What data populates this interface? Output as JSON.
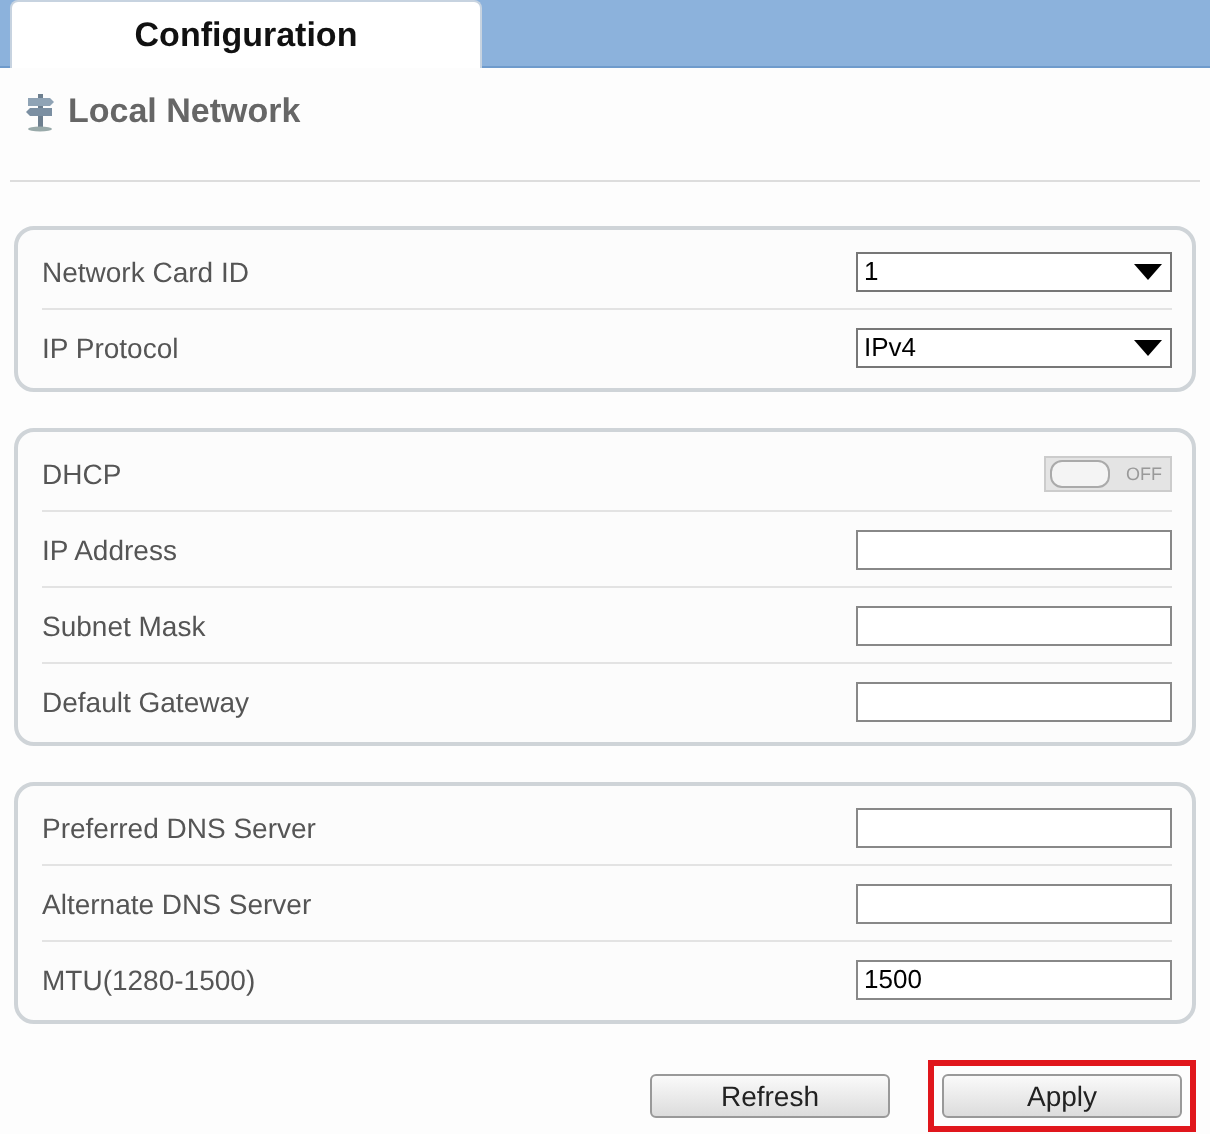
{
  "tabs": [
    {
      "label": "Configuration",
      "selected": true
    }
  ],
  "page": {
    "title": "Local Network"
  },
  "groups": [
    {
      "rows": [
        {
          "kind": "select",
          "label": "Network Card ID",
          "value": "1"
        },
        {
          "kind": "select",
          "label": "IP Protocol",
          "value": "IPv4"
        }
      ]
    },
    {
      "rows": [
        {
          "kind": "toggle",
          "label": "DHCP",
          "on": false,
          "state_text": "OFF"
        },
        {
          "kind": "text",
          "label": "IP Address"
        },
        {
          "kind": "text",
          "label": "Subnet Mask"
        },
        {
          "kind": "text",
          "label": "Default Gateway"
        }
      ]
    },
    {
      "rows": [
        {
          "kind": "text",
          "label": "Preferred DNS Server"
        },
        {
          "kind": "text",
          "label": "Alternate DNS Server"
        },
        {
          "kind": "text",
          "label": "MTU(1280-1500)",
          "value": "1500"
        }
      ]
    }
  ],
  "buttons": [
    {
      "label": "Refresh",
      "highlighted": false
    },
    {
      "label": "Apply",
      "highlighted": true
    }
  ]
}
